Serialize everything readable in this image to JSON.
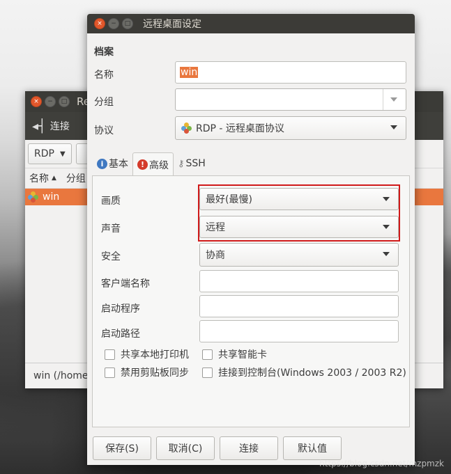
{
  "background_window": {
    "title": "Re",
    "toolbar_connect": "连接",
    "protocol_button": "RDP",
    "column_name": "名称",
    "column_group": "分组",
    "selected_item": "win",
    "status": "win (/home"
  },
  "dialog": {
    "title": "远程桌面设定",
    "section_title": "档案",
    "name_label": "名称",
    "name_value": "win",
    "group_label": "分组",
    "group_value": "",
    "protocol_label": "协议",
    "protocol_value": "RDP - 远程桌面协议",
    "tabs": [
      {
        "label": "基本",
        "icon": "info-icon"
      },
      {
        "label": "高级",
        "icon": "warning-icon"
      },
      {
        "label": "SSH",
        "icon": "key-icon"
      }
    ],
    "advanced": {
      "quality_label": "画质",
      "quality_value": "最好(最慢)",
      "sound_label": "声音",
      "sound_value": "远程",
      "security_label": "安全",
      "security_value": "协商",
      "client_name_label": "客户端名称",
      "client_name_value": "",
      "startup_program_label": "启动程序",
      "startup_program_value": "",
      "startup_path_label": "启动路径",
      "startup_path_value": "",
      "checkboxes": {
        "share_printer": "共享本地打印机",
        "share_smartcard": "共享智能卡",
        "disable_clipboard": "禁用剪贴板同步",
        "attach_console": "挂接到控制台(Windows 2003 / 2003 R2)"
      }
    },
    "buttons": {
      "save": "保存(S)",
      "cancel": "取消(C)",
      "connect": "连接",
      "default": "默认值"
    }
  },
  "watermark": "https://blog.csdn.net/mzpmzk",
  "colors": {
    "selection": "#e9773e",
    "highlight_box": "#d01a1a",
    "titlebar": "#3c3b37"
  }
}
